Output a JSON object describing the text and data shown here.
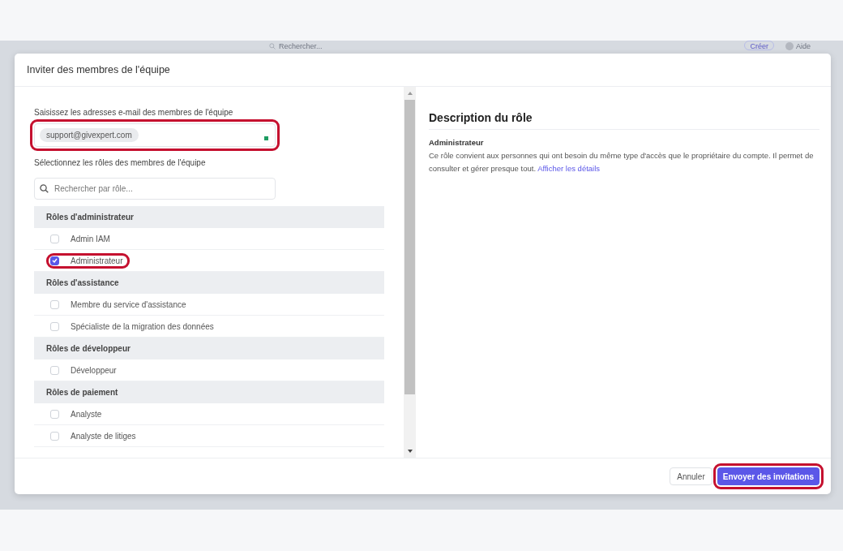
{
  "app_bar": {
    "search_placeholder": "Rechercher...",
    "create_button": "Créer",
    "help_link": "Aide"
  },
  "dialog": {
    "title": "Inviter des membres de l'équipe",
    "email_label": "Saisissez les adresses e-mail des membres de l'équipe",
    "emails": [
      "support@givexpert.com"
    ],
    "email_highlighted": true,
    "roles_label": "Sélectionnez les rôles des membres de l'équipe",
    "role_search_placeholder": "Rechercher par rôle...",
    "role_groups": [
      {
        "title": "Rôles d'administrateur",
        "roles": [
          {
            "label": "Admin IAM",
            "checked": false,
            "highlighted": false
          },
          {
            "label": "Administrateur",
            "checked": true,
            "highlighted": true
          }
        ]
      },
      {
        "title": "Rôles d'assistance",
        "roles": [
          {
            "label": "Membre du service d'assistance",
            "checked": false,
            "highlighted": false
          },
          {
            "label": "Spécialiste de la migration des données",
            "checked": false,
            "highlighted": false
          }
        ]
      },
      {
        "title": "Rôles de développeur",
        "roles": [
          {
            "label": "Développeur",
            "checked": false,
            "highlighted": false
          }
        ]
      },
      {
        "title": "Rôles de paiement",
        "roles": [
          {
            "label": "Analyste",
            "checked": false,
            "highlighted": false
          },
          {
            "label": "Analyste de litiges",
            "checked": false,
            "highlighted": false
          }
        ]
      }
    ],
    "description": {
      "heading": "Description du rôle",
      "role_name": "Administrateur",
      "text": "Ce rôle convient aux personnes qui ont besoin du même type d'accès que le propriétaire du compte. Il permet de consulter et gérer presque tout.",
      "link": "Afficher les détails"
    },
    "cancel_button": "Annuler",
    "submit_button": "Envoyer des invitations",
    "submit_highlighted": true
  }
}
